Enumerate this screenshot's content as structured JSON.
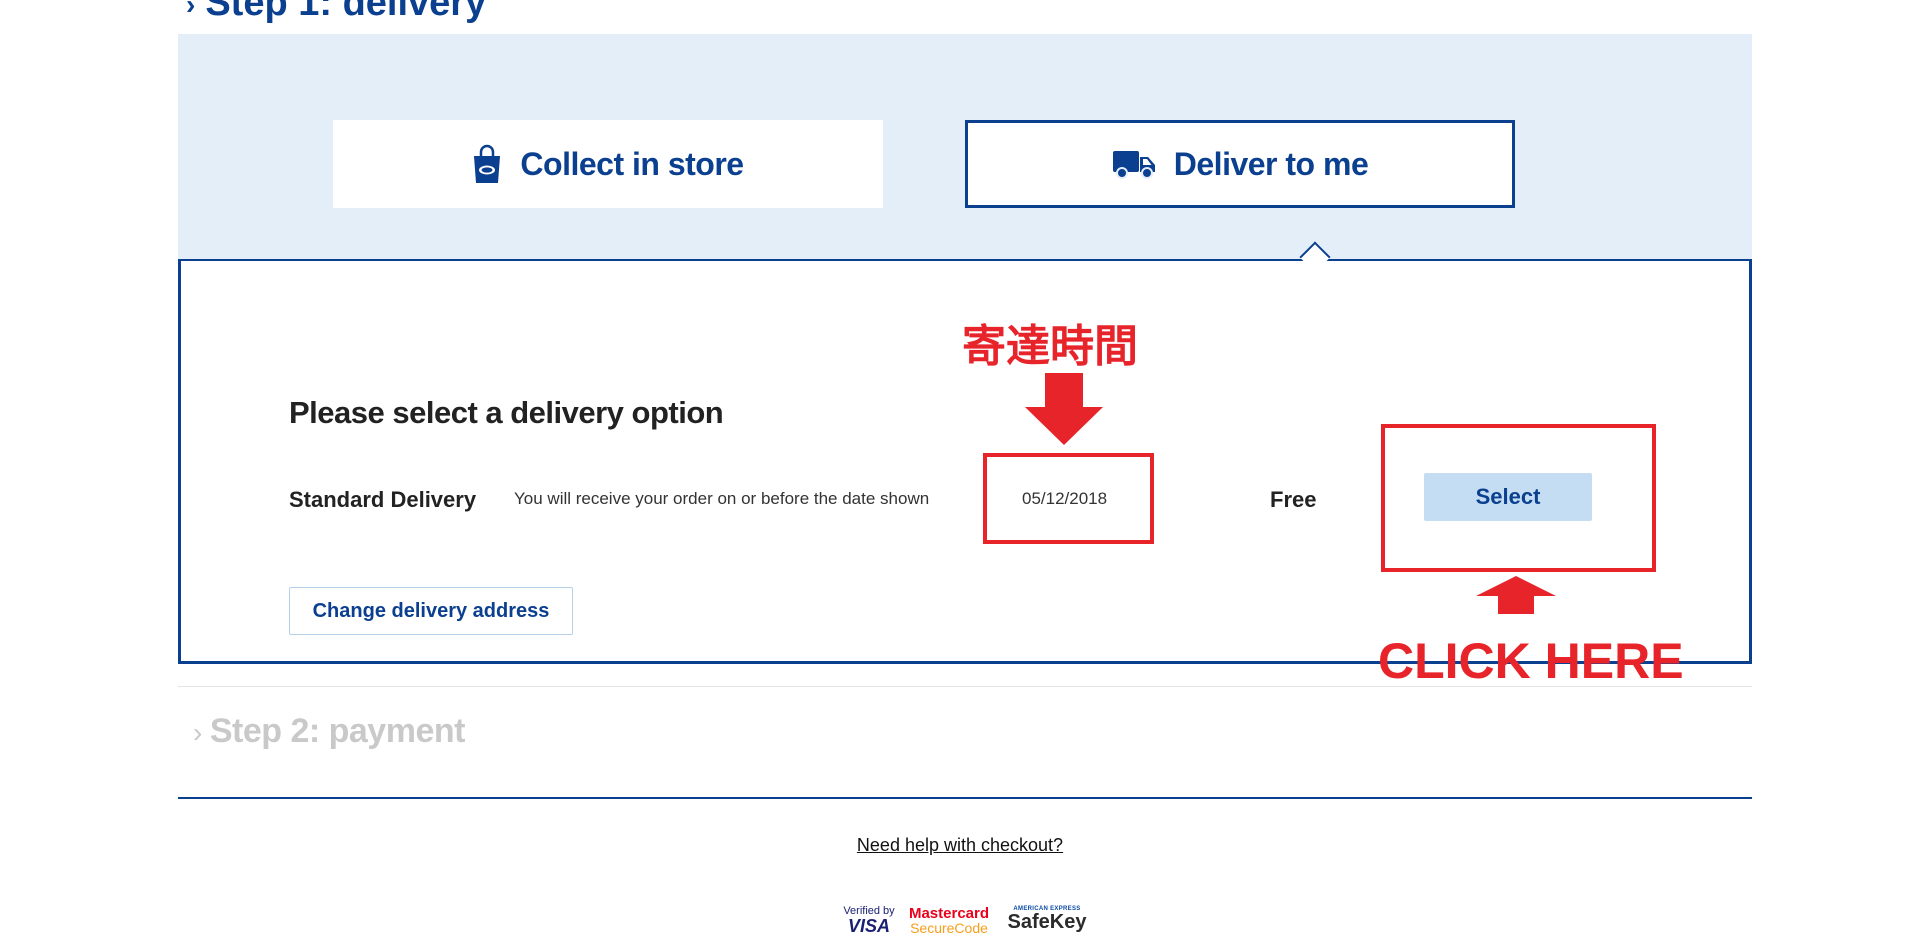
{
  "step1": {
    "header": "Step 1: delivery"
  },
  "delivery_options": {
    "collect_label": "Collect in store",
    "deliver_label": "Deliver to me",
    "selected": "Deliver to me"
  },
  "panel": {
    "title": "Please select a delivery option",
    "method": {
      "name": "Standard Delivery",
      "description": "You will receive your order on or before the date shown",
      "date": "05/12/2018",
      "price": "Free",
      "select_label": "Select"
    },
    "change_address_label": "Change delivery address"
  },
  "annotations": {
    "date_label": "寄達時間",
    "click_label": "CLICK HERE",
    "color": "#e8242b"
  },
  "step2": {
    "header": "Step 2: payment"
  },
  "help_link": "Need help with checkout?",
  "payment_logos": {
    "visa": {
      "line1": "Verified by",
      "line2": "VISA"
    },
    "mastercard": {
      "line1": "Mastercard",
      "line2": "SecureCode"
    },
    "amex": {
      "line1": "AMERICAN EXPRESS",
      "line2": "SafeKey"
    }
  },
  "colors": {
    "brand": "#0b3f8f",
    "band": "#e4eef9",
    "button": "#c5ddf3"
  }
}
